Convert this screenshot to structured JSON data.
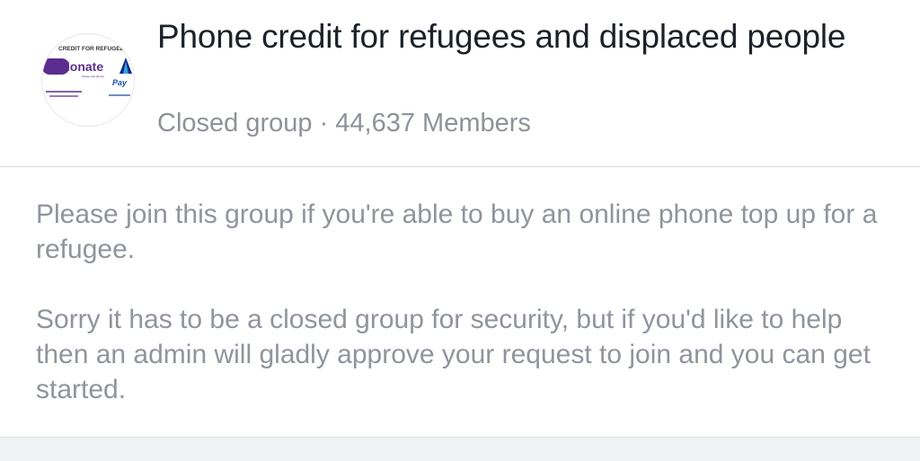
{
  "group": {
    "title": "Phone credit for refugees and displaced people",
    "privacy": "Closed group",
    "separator": "·",
    "members": "44,637 Members"
  },
  "avatar": {
    "logo_top_text": "CREDIT FOR REFUGEE",
    "logo_brand": "mydonate",
    "logo_pay": "Pay",
    "accent": "#5b2d8e"
  },
  "description": {
    "paragraphs": [
      "Please join this group if you're able to buy an online phone top up for a refugee.",
      "Sorry it has to be a closed group for security, but if you'd like to help then an admin will gladly approve your request to join and you can get started."
    ]
  },
  "colors": {
    "title": "#1d2129",
    "subtle_text": "#90949c",
    "divider": "#dddfe2"
  }
}
